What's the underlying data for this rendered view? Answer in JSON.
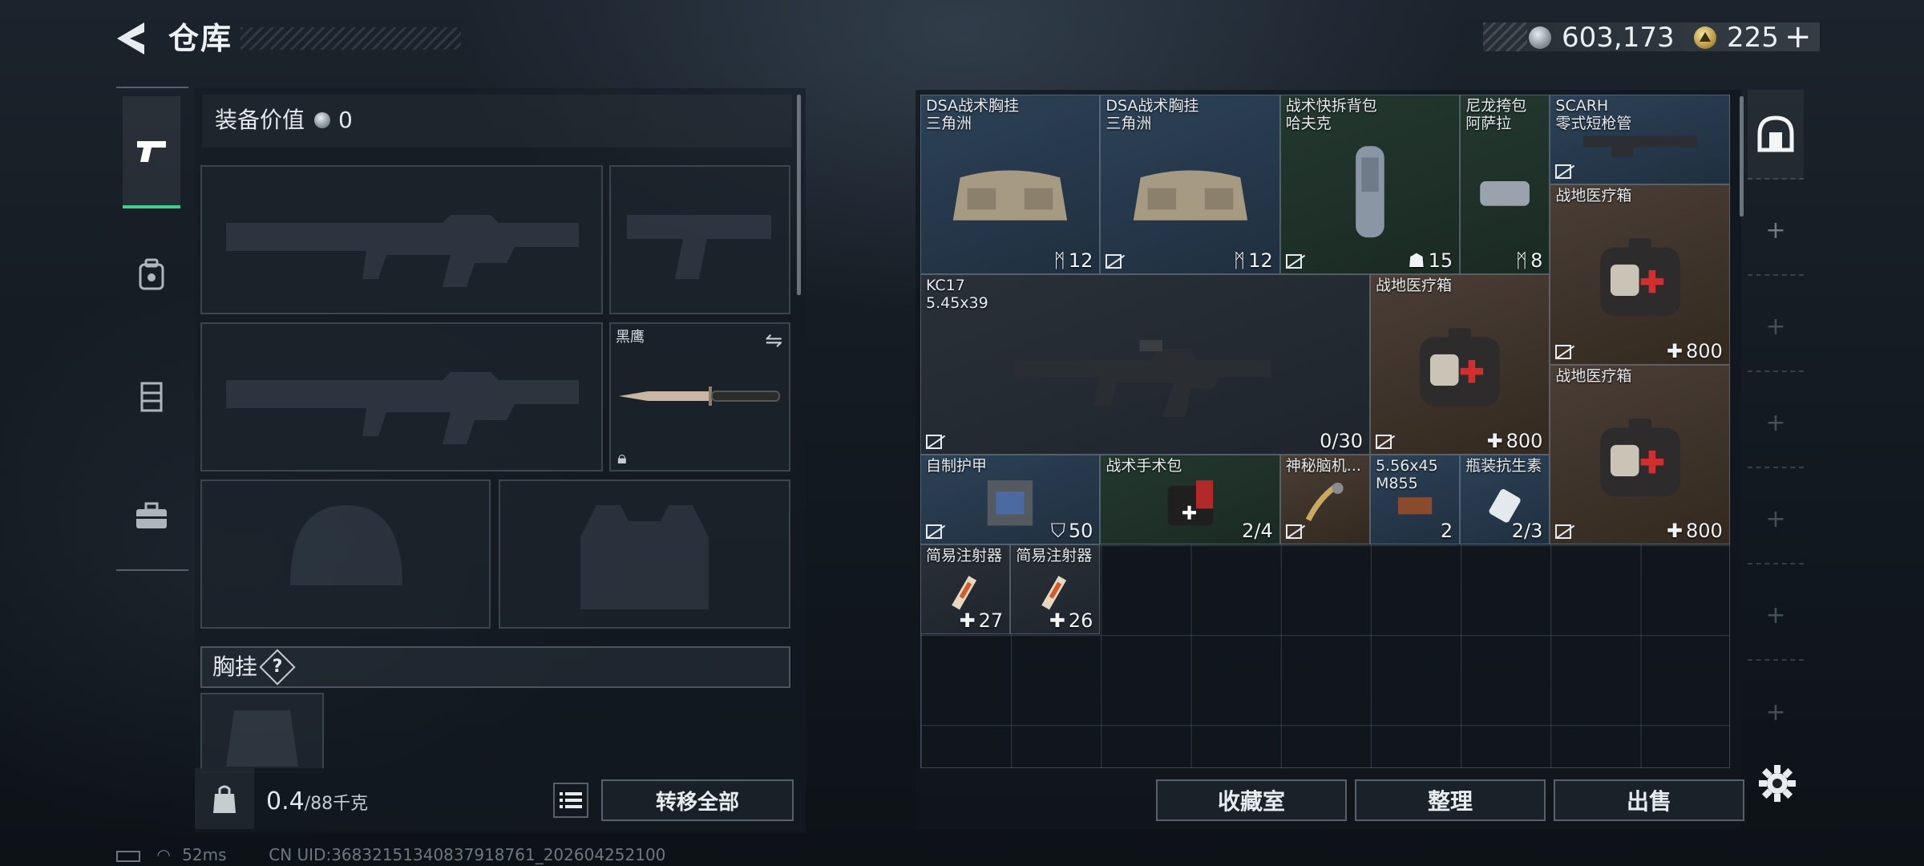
{
  "header": {
    "title": "仓库",
    "currency_silver": "603,173",
    "currency_gold": "225",
    "add_label": "+"
  },
  "nav": {
    "tabs": [
      {
        "icon": "pistol-icon",
        "active": true
      },
      {
        "icon": "backpack-icon",
        "active": false
      },
      {
        "icon": "vest-icon",
        "active": false
      },
      {
        "icon": "briefcase-icon",
        "active": false
      }
    ]
  },
  "equipment": {
    "value_label": "装备价值",
    "value": "0",
    "melee_slot": {
      "name": "黑鹰"
    },
    "rig_label": "胸挂",
    "rig_help": "?",
    "weight_current": "0.4",
    "weight_max": "/88千克",
    "transfer_all_label": "转移全部"
  },
  "stash": {
    "items": [
      {
        "name": "DSA战术胸挂",
        "sub": "三角洲",
        "qty": "12",
        "qty_icon": "capacity-icon",
        "non_tradeable": false,
        "bg": "#2d4257"
      },
      {
        "name": "DSA战术胸挂",
        "sub": "三角洲",
        "qty": "12",
        "qty_icon": "capacity-icon",
        "non_tradeable": true,
        "bg": "#2d4257"
      },
      {
        "name": "战术快拆背包",
        "sub": "哈夫克",
        "qty": "15",
        "qty_icon": "backpack-capacity-icon",
        "non_tradeable": true,
        "bg": "#24382f"
      },
      {
        "name": "尼龙挎包",
        "sub": "阿萨拉",
        "qty": "8",
        "qty_icon": "capacity-icon",
        "non_tradeable": false,
        "bg": "#24382f"
      },
      {
        "name": "SCARH",
        "sub": "零式短枪管",
        "qty": "",
        "non_tradeable": true,
        "bg": "#2d4257"
      },
      {
        "name": "KC17",
        "sub": "5.45x39",
        "qty": "0/30",
        "non_tradeable": true,
        "bg": "#2a3038"
      },
      {
        "name": "战地医疗箱",
        "sub": "",
        "qty": "800",
        "qty_icon": "plus-icon",
        "non_tradeable": true,
        "bg": "#4a3e36"
      },
      {
        "name": "战地医疗箱",
        "sub": "",
        "qty": "800",
        "qty_icon": "plus-icon",
        "non_tradeable": true,
        "bg": "#4a3e36"
      },
      {
        "name": "战地医疗箱",
        "sub": "",
        "qty": "800",
        "qty_icon": "plus-icon",
        "non_tradeable": true,
        "bg": "#4a3e36"
      },
      {
        "name": "自制护甲",
        "sub": "",
        "qty": "50",
        "qty_icon": "shield-icon",
        "non_tradeable": true,
        "bg": "#2d4257"
      },
      {
        "name": "战术手术包",
        "sub": "",
        "qty": "2/4",
        "non_tradeable": false,
        "bg": "#24382f"
      },
      {
        "name": "神秘脑机...",
        "sub": "",
        "qty": "",
        "non_tradeable": true,
        "bg": "#4a3e36"
      },
      {
        "name": "5.56x45",
        "sub": "M855",
        "qty": "2",
        "non_tradeable": false,
        "bg": "#2d4257"
      },
      {
        "name": "瓶装抗生素",
        "sub": "",
        "qty": "2/3",
        "non_tradeable": false,
        "bg": "#2d4257"
      },
      {
        "name": "简易注射器",
        "sub": "",
        "qty": "27",
        "qty_icon": "plus-icon",
        "non_tradeable": false,
        "bg": "#2a3038"
      },
      {
        "name": "简易注射器",
        "sub": "",
        "qty": "26",
        "qty_icon": "plus-icon",
        "non_tradeable": false,
        "bg": "#2a3038"
      }
    ],
    "buttons": {
      "collection": "收藏室",
      "organize": "整理",
      "sell": "出售"
    }
  },
  "status": {
    "ping": "52ms",
    "uid": "CN UID:36832151340837918761_202604252100"
  }
}
